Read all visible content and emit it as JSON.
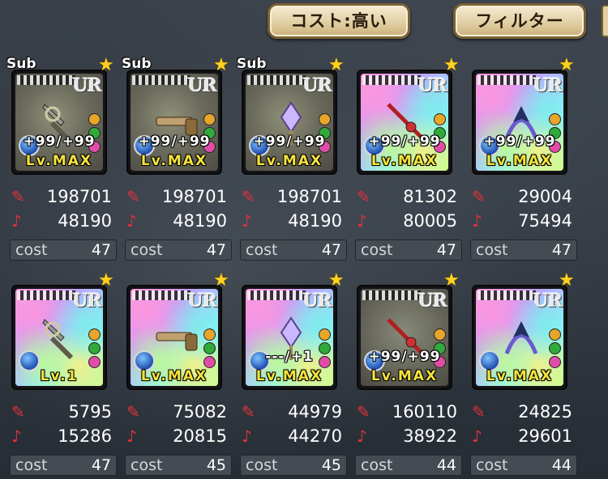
{
  "header": {
    "sort_button_label": "コスト:高い",
    "filter_button_label": "フィルター"
  },
  "cards": [
    {
      "sub": "Sub",
      "art": "gray",
      "plus": "+99/+99",
      "level": "Lv.MAX",
      "attack": "198701",
      "defense": "48190",
      "cost_label": "cost",
      "cost": "47"
    },
    {
      "sub": "Sub",
      "art": "gray",
      "plus": "+99/+99",
      "level": "Lv.MAX",
      "attack": "198701",
      "defense": "48190",
      "cost_label": "cost",
      "cost": "47"
    },
    {
      "sub": "Sub",
      "art": "gray",
      "plus": "+99/+99",
      "level": "Lv.MAX",
      "attack": "198701",
      "defense": "48190",
      "cost_label": "cost",
      "cost": "47"
    },
    {
      "sub": "",
      "art": "rain",
      "plus": "+99/+99",
      "level": "Lv.MAX",
      "attack": "81302",
      "defense": "80005",
      "cost_label": "cost",
      "cost": "47"
    },
    {
      "sub": "",
      "art": "rain",
      "plus": "+99/+99",
      "level": "Lv.MAX",
      "attack": "29004",
      "defense": "75494",
      "cost_label": "cost",
      "cost": "47"
    },
    {
      "sub": "",
      "art": "rain",
      "plus": "",
      "level": "Lv.1",
      "attack": "5795",
      "defense": "15286",
      "cost_label": "cost",
      "cost": "47"
    },
    {
      "sub": "",
      "art": "rain",
      "plus": "",
      "level": "Lv.MAX",
      "attack": "75082",
      "defense": "20815",
      "cost_label": "cost",
      "cost": "45"
    },
    {
      "sub": "",
      "art": "rain",
      "plus": "---/+1",
      "level": "Lv.MAX",
      "attack": "44979",
      "defense": "44270",
      "cost_label": "cost",
      "cost": "45"
    },
    {
      "sub": "",
      "art": "grayblue",
      "plus": "+99/+99",
      "level": "Lv.MAX",
      "attack": "160110",
      "defense": "38922",
      "cost_label": "cost",
      "cost": "44"
    },
    {
      "sub": "",
      "art": "rain",
      "plus": "",
      "level": "Lv.MAX",
      "attack": "24825",
      "defense": "29601",
      "cost_label": "cost",
      "cost": "44"
    }
  ],
  "icons": {
    "rarity": "UR",
    "star": "star-icon",
    "attack": "attack-icon",
    "defense": "defense-icon",
    "element": "element-orb-icon"
  },
  "colors": {
    "level_text": "#f5e33b",
    "stat_icon": "#e0323a",
    "button_bg": "#e2cfa4"
  }
}
